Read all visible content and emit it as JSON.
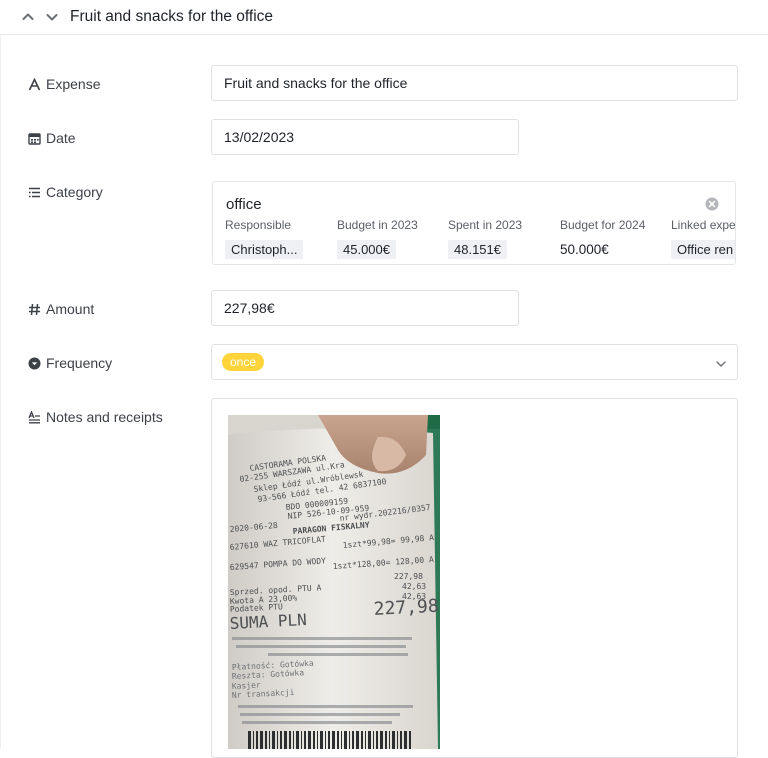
{
  "header": {
    "title": "Fruit and snacks for the office"
  },
  "fields": {
    "expense": {
      "label": "Expense",
      "value": "Fruit and snacks for the office"
    },
    "date": {
      "label": "Date",
      "value": "13/02/2023"
    },
    "category": {
      "label": "Category",
      "name": "office",
      "columns": [
        {
          "header": "Responsible",
          "value": "Christoph..."
        },
        {
          "header": "Budget in 2023",
          "value": "45.000€"
        },
        {
          "header": "Spent in 2023",
          "value": "48.151€"
        },
        {
          "header": "Budget for 2024",
          "value": "50.000€"
        },
        {
          "header": "Linked expe",
          "value": "Office ren"
        }
      ]
    },
    "amount": {
      "label": "Amount",
      "value": "227,98€"
    },
    "frequency": {
      "label": "Frequency",
      "value": "once"
    },
    "notes": {
      "label": "Notes and receipts"
    }
  },
  "receipt": {
    "lines": [
      "CASTORAMA POLSKA",
      "02-255 WARSZAWA ul.Kra",
      "Sklep Łódź ul.Wróblewsk",
      "93-566 Łódź tel. 42 6837100",
      "BDO 000009159",
      "NIP 526-10-09-959",
      "nr wydr.202216/0357",
      "2020-06-28",
      "PARAGON FISKALNY",
      "627610 WAZ TRICOFLAT",
      "1szt*99,98= 99,98 A",
      "629547 POMPA DO WODY",
      "1szt*128,00= 128,00 A",
      "227,98",
      "Sprzed. opod. PTU A",
      "Kwota A 23,00%",
      "42,63",
      "Podatek PTU",
      "42,63",
      "SUMA PLN",
      "227,98",
      "Płatność: Gotówka",
      "Reszta: Gotówka",
      "Kasjer",
      "Nr transakcji"
    ]
  },
  "colors": {
    "accent": "#ffd43b",
    "border": "#dfe1e5",
    "chip": "#eef0f3"
  }
}
